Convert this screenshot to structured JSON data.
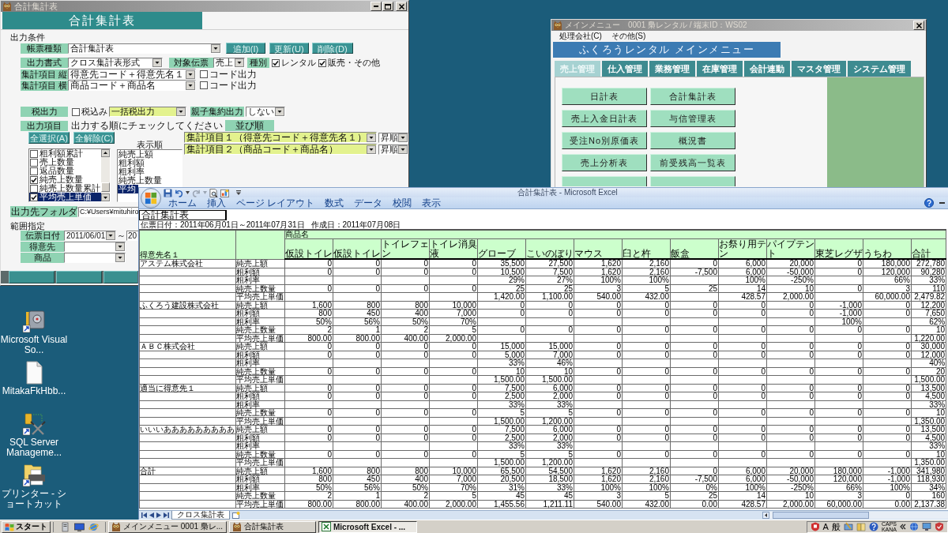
{
  "desktop_icons": [
    {
      "kind": "safe",
      "label": "Microsoft Visual So..."
    },
    {
      "kind": "document",
      "label": "MitakaFkHbb..."
    },
    {
      "kind": "database",
      "label": "SQL Server Manageme..."
    },
    {
      "kind": "printer",
      "label": "プリンター - ショートカット"
    }
  ],
  "report_window": {
    "title": "合計集計表",
    "active": false,
    "heading": "合計集計表",
    "conditions_label": "出力条件",
    "report_type": {
      "label": "帳票種類",
      "value": "合計集計表"
    },
    "actions": [
      "追加(I)",
      "更新(U)",
      "削除(D)"
    ],
    "format": {
      "label": "出力書式",
      "value": "クロス集計表形式"
    },
    "target": {
      "label": "対象伝票",
      "value": "売上"
    },
    "category": {
      "label": "種別",
      "options": [
        {
          "label": "レンタル",
          "checked": true
        },
        {
          "label": "販売・その他",
          "checked": true
        }
      ]
    },
    "axes": [
      {
        "label": "集計項目 縦",
        "value": "得意先コード＋得意先名１",
        "option": {
          "label": "コード出力",
          "checked": false
        }
      },
      {
        "label": "集計項目 横",
        "value": "商品コード＋商品名",
        "option": {
          "label": "コード出力",
          "checked": false
        }
      }
    ],
    "tax": {
      "label": "税出力",
      "option": {
        "label": "税込み",
        "checked": false
      },
      "value": "一括税出力"
    },
    "grouping": {
      "label": "親子集約出力",
      "value": "しない"
    },
    "output_items": {
      "label": "出力項目",
      "instruction": "出力する順にチェックしてください",
      "buttons": [
        "全選択(A)",
        "全解除(C)"
      ],
      "items": [
        {
          "label": "粗利額累計",
          "checked": false,
          "selected": false
        },
        {
          "label": "売上数量",
          "checked": false,
          "selected": false
        },
        {
          "label": "返品数量",
          "checked": false,
          "selected": false
        },
        {
          "label": "純売上数量",
          "checked": true,
          "selected": false
        },
        {
          "label": "純売上数量累計",
          "checked": false,
          "selected": false
        },
        {
          "label": "平均売上単価",
          "checked": true,
          "selected": true
        }
      ],
      "order_label": "表示順",
      "order": [
        {
          "label": "純売上額",
          "selected": false
        },
        {
          "label": "粗利額",
          "selected": false
        },
        {
          "label": "粗利率",
          "selected": false
        },
        {
          "label": "純売上数量",
          "selected": false
        },
        {
          "label": "平均",
          "selected": true
        }
      ]
    },
    "sort": {
      "label": "並び順",
      "keys": [
        {
          "value": "集計項目１（得意先コード＋得意先名１）",
          "direction": "昇順"
        },
        {
          "value": "集計項目２（商品コード＋商品名）",
          "direction": "昇順"
        }
      ]
    },
    "folder": {
      "label": "出力先フォルダ",
      "value": "C:¥Users¥mituhiro"
    },
    "range_label": "範囲指定",
    "date": {
      "label": "伝票日付",
      "from": "2011/06/01",
      "separator": "～",
      "to": "20"
    },
    "filters": [
      {
        "label": "得意先"
      },
      {
        "label": "商品"
      }
    ]
  },
  "menu_window": {
    "title": "メインメニュー　0001 梟レンタル / 端末ID：WS02",
    "active": false,
    "menu": [
      "処理会社(C)",
      "その他(S)"
    ],
    "heading": "ふくろうレンタル メインメニュー",
    "tabs": [
      {
        "label": "売上管理",
        "selected": true
      },
      {
        "label": "仕入管理",
        "selected": false
      },
      {
        "label": "業務管理",
        "selected": false
      },
      {
        "label": "在庫管理",
        "selected": false
      },
      {
        "label": "会計連動",
        "selected": false
      },
      {
        "label": "マスタ管理",
        "selected": false
      },
      {
        "label": "システム管理",
        "selected": false
      }
    ],
    "buttons": [
      "日計表",
      "合計集計表",
      "売上入金日計表",
      "与信管理表",
      "受注No別原価表",
      "概況書",
      "売上分析表",
      "前受残高一覧表"
    ]
  },
  "excel_window": {
    "title": "合計集計表 - Microsoft Excel",
    "ribbon_tabs": [
      "ホーム",
      "挿入",
      "ページ レイアウト",
      "数式",
      "データ",
      "校閲",
      "表示"
    ],
    "sheet": {
      "title": "合計集計表",
      "period": "伝票日付：2011年06月01日～2011年07月31日",
      "created": "作成日：2011年07月08日",
      "customer_header": "得意先名１",
      "product_header": "商品名",
      "products": [
        "仮設トイレ",
        "仮設トイレ",
        "トイレフェン",
        "トイレ消臭液",
        "グローブ",
        "こいのぼり",
        "マウス",
        "臼と杵",
        "飯盒",
        "お祭り用テン",
        "パイプテント",
        "東芝レグザ",
        "うちわ"
      ],
      "total_header": "合計",
      "groups": [
        {
          "customer": "アステム株式会社",
          "rows": [
            {
              "metric": "純売上額",
              "cells": {
                "col_1": "0",
                "col_2": "0",
                "col_3": "0",
                "col_4": "0",
                "col_5": "35,500",
                "col_6": "27,500",
                "col_7": "1,620",
                "col_8": "2,160",
                "col_9": "0",
                "col_10": "6,000",
                "col_11": "20,000",
                "col_12": "0",
                "col_13": "180,000"
              },
              "total": "272,780"
            },
            {
              "metric": "粗利額",
              "cells": {
                "col_1": "0",
                "col_2": "0",
                "col_3": "0",
                "col_4": "0",
                "col_5": "10,500",
                "col_6": "7,500",
                "col_7": "1,620",
                "col_8": "2,160",
                "col_9": "-7,500",
                "col_10": "6,000",
                "col_11": "-50,000",
                "col_12": "0",
                "col_13": "120,000"
              },
              "total": "90,280"
            },
            {
              "metric": "粗利率",
              "cells": {
                "col_5": "29%",
                "col_6": "27%",
                "col_7": "100%",
                "col_8": "100%",
                "col_10": "100%",
                "col_11": "-250%",
                "col_13": "66%"
              },
              "total": "33%"
            },
            {
              "metric": "純売上数量",
              "cells": {
                "col_1": "0",
                "col_2": "0",
                "col_3": "0",
                "col_4": "0",
                "col_5": "25",
                "col_6": "25",
                "col_7": "3",
                "col_8": "5",
                "col_9": "25",
                "col_10": "14",
                "col_11": "10",
                "col_12": "0",
                "col_13": "3"
              },
              "total": "110"
            },
            {
              "metric": "平均売上単価",
              "cells": {
                "col_5": "1,420.00",
                "col_6": "1,100.00",
                "col_7": "540.00",
                "col_8": "432.00",
                "col_10": "428.57",
                "col_11": "2,000.00",
                "col_13": "60,000.00"
              },
              "total": "2,479.82"
            }
          ]
        },
        {
          "customer": "ふくろう建設株式会社",
          "rows": [
            {
              "metric": "純売上額",
              "cells": {
                "col_1": "1,600",
                "col_2": "800",
                "col_3": "800",
                "col_4": "10,000",
                "col_5": "0",
                "col_6": "0",
                "col_7": "0",
                "col_8": "0",
                "col_9": "0",
                "col_10": "0",
                "col_11": "0",
                "col_12": "-1,000",
                "col_13": "0"
              },
              "total": "12,200"
            },
            {
              "metric": "粗利額",
              "cells": {
                "col_1": "800",
                "col_2": "450",
                "col_3": "400",
                "col_4": "7,000",
                "col_5": "0",
                "col_6": "0",
                "col_7": "0",
                "col_8": "0",
                "col_9": "0",
                "col_10": "0",
                "col_11": "0",
                "col_12": "-1,000",
                "col_13": "0"
              },
              "total": "7,650"
            },
            {
              "metric": "粗利率",
              "cells": {
                "col_1": "50%",
                "col_2": "56%",
                "col_3": "50%",
                "col_4": "70%",
                "col_12": "100%"
              },
              "total": "62%"
            },
            {
              "metric": "純売上数量",
              "cells": {
                "col_1": "2",
                "col_2": "1",
                "col_3": "2",
                "col_4": "5",
                "col_5": "0",
                "col_6": "0",
                "col_7": "0",
                "col_8": "0",
                "col_9": "0",
                "col_10": "0",
                "col_11": "0",
                "col_12": "0",
                "col_13": "0"
              },
              "total": "10"
            },
            {
              "metric": "平均売上単価",
              "cells": {
                "col_1": "800.00",
                "col_2": "800.00",
                "col_3": "400.00",
                "col_4": "2,000.00"
              },
              "total": "1,220.00"
            }
          ]
        },
        {
          "customer": "ＡＢＣ株式会社",
          "rows": [
            {
              "metric": "純売上額",
              "cells": {
                "col_1": "0",
                "col_2": "0",
                "col_3": "0",
                "col_4": "0",
                "col_5": "15,000",
                "col_6": "15,000",
                "col_7": "0",
                "col_8": "0",
                "col_9": "0",
                "col_10": "0",
                "col_11": "0",
                "col_12": "0",
                "col_13": "0"
              },
              "total": "30,000"
            },
            {
              "metric": "粗利額",
              "cells": {
                "col_1": "0",
                "col_2": "0",
                "col_3": "0",
                "col_4": "0",
                "col_5": "5,000",
                "col_6": "7,000",
                "col_7": "0",
                "col_8": "0",
                "col_9": "0",
                "col_10": "0",
                "col_11": "0",
                "col_12": "0",
                "col_13": "0"
              },
              "total": "12,000"
            },
            {
              "metric": "粗利率",
              "cells": {
                "col_5": "33%",
                "col_6": "46%"
              },
              "total": "40%"
            },
            {
              "metric": "純売上数量",
              "cells": {
                "col_1": "0",
                "col_2": "0",
                "col_3": "0",
                "col_4": "0",
                "col_5": "10",
                "col_6": "10",
                "col_7": "0",
                "col_8": "0",
                "col_9": "0",
                "col_10": "0",
                "col_11": "0",
                "col_12": "0",
                "col_13": "0"
              },
              "total": "20"
            },
            {
              "metric": "平均売上単価",
              "cells": {
                "col_5": "1,500.00",
                "col_6": "1,500.00"
              },
              "total": "1,500.00"
            }
          ]
        },
        {
          "customer": "適当に得意先１",
          "rows": [
            {
              "metric": "純売上額",
              "cells": {
                "col_1": "0",
                "col_2": "0",
                "col_3": "0",
                "col_4": "0",
                "col_5": "7,500",
                "col_6": "6,000",
                "col_7": "0",
                "col_8": "0",
                "col_9": "0",
                "col_10": "0",
                "col_11": "0",
                "col_12": "0",
                "col_13": "0"
              },
              "total": "13,500"
            },
            {
              "metric": "粗利額",
              "cells": {
                "col_1": "0",
                "col_2": "0",
                "col_3": "0",
                "col_4": "0",
                "col_5": "2,500",
                "col_6": "2,000",
                "col_7": "0",
                "col_8": "0",
                "col_9": "0",
                "col_10": "0",
                "col_11": "0",
                "col_12": "0",
                "col_13": "0"
              },
              "total": "4,500"
            },
            {
              "metric": "粗利率",
              "cells": {
                "col_5": "33%",
                "col_6": "33%"
              },
              "total": "33%"
            },
            {
              "metric": "純売上数量",
              "cells": {
                "col_1": "0",
                "col_2": "0",
                "col_3": "0",
                "col_4": "0",
                "col_5": "5",
                "col_6": "5",
                "col_7": "0",
                "col_8": "0",
                "col_9": "0",
                "col_10": "0",
                "col_11": "0",
                "col_12": "0",
                "col_13": "0"
              },
              "total": "10"
            },
            {
              "metric": "平均売上単価",
              "cells": {
                "col_5": "1,500.00",
                "col_6": "1,200.00"
              },
              "total": "1,350.00"
            }
          ]
        },
        {
          "customer": "いいいあああああああああ",
          "rows": [
            {
              "metric": "純売上額",
              "cells": {
                "col_1": "0",
                "col_2": "0",
                "col_3": "0",
                "col_4": "0",
                "col_5": "7,500",
                "col_6": "6,000",
                "col_7": "0",
                "col_8": "0",
                "col_9": "0",
                "col_10": "0",
                "col_11": "0",
                "col_12": "0",
                "col_13": "0"
              },
              "total": "13,500"
            },
            {
              "metric": "粗利額",
              "cells": {
                "col_1": "0",
                "col_2": "0",
                "col_3": "0",
                "col_4": "0",
                "col_5": "2,500",
                "col_6": "2,000",
                "col_7": "0",
                "col_8": "0",
                "col_9": "0",
                "col_10": "0",
                "col_11": "0",
                "col_12": "0",
                "col_13": "0"
              },
              "total": "4,500"
            },
            {
              "metric": "粗利率",
              "cells": {
                "col_5": "33%",
                "col_6": "33%"
              },
              "total": "33%"
            },
            {
              "metric": "純売上数量",
              "cells": {
                "col_1": "0",
                "col_2": "0",
                "col_3": "0",
                "col_4": "0",
                "col_5": "5",
                "col_6": "5",
                "col_7": "0",
                "col_8": "0",
                "col_9": "0",
                "col_10": "0",
                "col_11": "0",
                "col_12": "0",
                "col_13": "0"
              },
              "total": "10"
            },
            {
              "metric": "平均売上単価",
              "cells": {
                "col_5": "1,500.00",
                "col_6": "1,200.00"
              },
              "total": "1,350.00"
            }
          ]
        },
        {
          "customer": "合計",
          "rows": [
            {
              "metric": "純売上額",
              "cells": {
                "col_1": "1,600",
                "col_2": "800",
                "col_3": "800",
                "col_4": "10,000",
                "col_5": "65,500",
                "col_6": "54,500",
                "col_7": "1,620",
                "col_8": "2,160",
                "col_9": "0",
                "col_10": "6,000",
                "col_11": "20,000",
                "col_12": "180,000",
                "col_13": "-1,000"
              },
              "total": "341,980"
            },
            {
              "metric": "粗利額",
              "cells": {
                "col_1": "800",
                "col_2": "450",
                "col_3": "400",
                "col_4": "7,000",
                "col_5": "20,500",
                "col_6": "18,500",
                "col_7": "1,620",
                "col_8": "2,160",
                "col_9": "-7,500",
                "col_10": "6,000",
                "col_11": "-50,000",
                "col_12": "120,000",
                "col_13": "-1,000"
              },
              "total": "118,930"
            },
            {
              "metric": "粗利率",
              "cells": {
                "col_1": "50%",
                "col_2": "56%",
                "col_3": "50%",
                "col_4": "70%",
                "col_5": "31%",
                "col_6": "33%",
                "col_7": "100%",
                "col_8": "100%",
                "col_9": "0%",
                "col_10": "100%",
                "col_11": "-250%",
                "col_12": "66%",
                "col_13": "100%"
              },
              "total": "34%"
            },
            {
              "metric": "純売上数量",
              "cells": {
                "col_1": "2",
                "col_2": "1",
                "col_3": "2",
                "col_4": "5",
                "col_5": "45",
                "col_6": "45",
                "col_7": "3",
                "col_8": "5",
                "col_9": "25",
                "col_10": "14",
                "col_11": "10",
                "col_12": "3",
                "col_13": "0"
              },
              "total": "160"
            },
            {
              "metric": "平均売上単価",
              "cells": {
                "col_1": "800.00",
                "col_2": "800.00",
                "col_3": "400.00",
                "col_4": "2,000.00",
                "col_5": "1,455.56",
                "col_6": "1,211.11",
                "col_7": "540.00",
                "col_8": "432.00",
                "col_9": "0.00",
                "col_10": "428.57",
                "col_11": "2,000.00",
                "col_12": "60,000.00",
                "col_13": "0.00"
              },
              "total": "2,137.38"
            }
          ]
        }
      ]
    },
    "sheet_tabs": [
      {
        "label": "クロス集計表",
        "selected": true
      }
    ]
  },
  "taskbar": {
    "start": "スタート",
    "tasks": [
      {
        "kind": "owl",
        "label": "メインメニュー 0001 梟レ...",
        "selected": false
      },
      {
        "kind": "owl",
        "label": "合計集計表",
        "selected": false
      },
      {
        "kind": "excel",
        "label": "Microsoft Excel - ...",
        "selected": true
      }
    ],
    "ime": [
      "A",
      "般"
    ],
    "keys": [
      "CAPS",
      "KANA"
    ]
  }
}
